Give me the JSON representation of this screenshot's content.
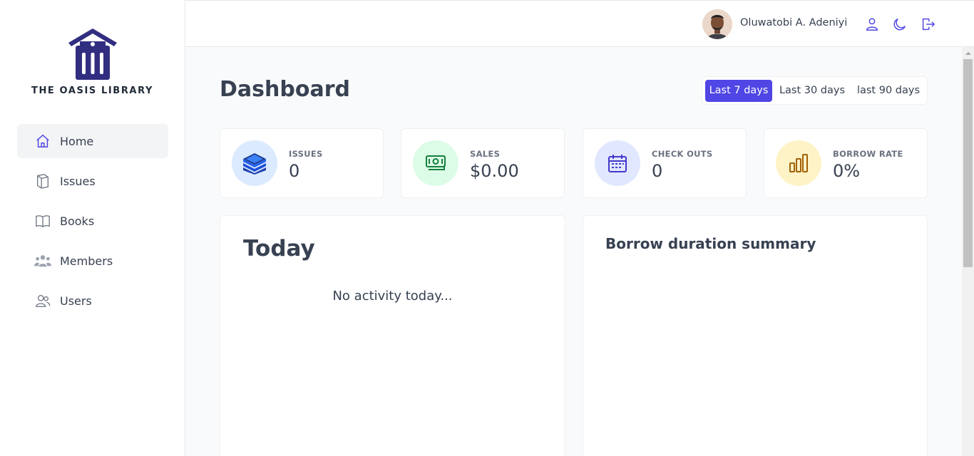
{
  "sidebar": {
    "logo_text": "THE OASIS LIBRARY",
    "items": [
      {
        "label": "Home",
        "icon": "home-icon",
        "active": true
      },
      {
        "label": "Issues",
        "icon": "book-stack-icon"
      },
      {
        "label": "Books",
        "icon": "open-book-icon"
      },
      {
        "label": "Members",
        "icon": "members-icon"
      },
      {
        "label": "Users",
        "icon": "users-icon"
      }
    ]
  },
  "topbar": {
    "username": "Oluwatobi A. Adeniyi",
    "icons": [
      "user-icon",
      "moon-icon",
      "logout-icon"
    ]
  },
  "main": {
    "title": "Dashboard",
    "ranges": [
      "Last 7 days",
      "Last 30 days",
      "last 90 days"
    ],
    "selected_range": "Last 7 days",
    "stats": [
      {
        "label": "ISSUES",
        "value": "0",
        "icon": "books-icon",
        "color": "#dbeafe"
      },
      {
        "label": "SALES",
        "value": "$0.00",
        "icon": "cash-icon",
        "color": "#dcfce7"
      },
      {
        "label": "CHECK OUTS",
        "value": "0",
        "icon": "calendar-icon",
        "color": "#e0e7ff"
      },
      {
        "label": "BORROW RATE",
        "value": "0%",
        "icon": "bar-chart-icon",
        "color": "#fef3c7"
      }
    ],
    "today": {
      "title": "Today",
      "empty_text": "No activity today..."
    },
    "borrow_summary": {
      "title": "Borrow duration summary"
    }
  },
  "colors": {
    "accent": "#4f46e5",
    "logo": "#312e81"
  }
}
